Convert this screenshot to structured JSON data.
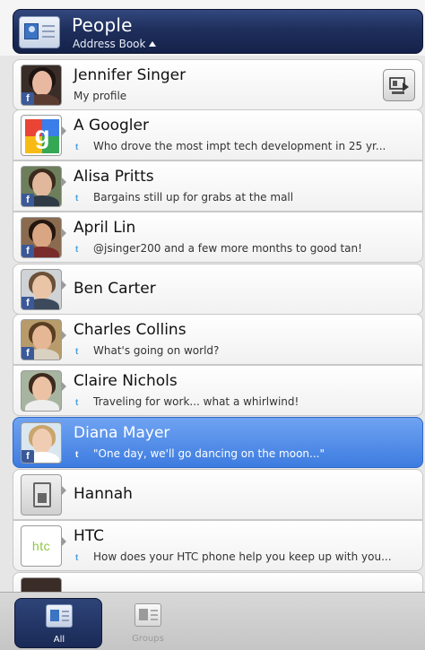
{
  "header": {
    "title": "People",
    "subtitle": "Address Book"
  },
  "contacts": [
    {
      "name": "Jennifer Singer",
      "status": "My profile",
      "avatar": "photo-woman-dark-hair",
      "badge": "f",
      "profile_button_icon": "send-card-icon"
    },
    {
      "name": "A Googler",
      "status": "Who drove the most impt tech development in 25 yr...",
      "avatar": "google-logo",
      "badge": "",
      "status_icon": "twitter-icon"
    },
    {
      "name": "Alisa Pritts",
      "status": "Bargains still up for grabs at the mall",
      "avatar": "photo-woman",
      "badge": "f",
      "status_icon": "twitter-icon"
    },
    {
      "name": "April Lin",
      "status": "@jsinger200 and a few more months to good tan!",
      "avatar": "photo-woman",
      "badge": "f",
      "status_icon": "twitter-icon"
    },
    {
      "name": "Ben Carter",
      "status": "",
      "avatar": "photo-man",
      "badge": "f"
    },
    {
      "name": "Charles Collins",
      "status": "What's going on world?",
      "avatar": "photo-man-smiling",
      "badge": "f",
      "status_icon": "twitter-icon"
    },
    {
      "name": "Claire Nichols",
      "status": "Traveling for work... what a whirlwind!",
      "avatar": "photo-woman",
      "badge": "",
      "status_icon": "twitter-icon"
    },
    {
      "name": "Diana Mayer",
      "status": "\"One day, we'll go dancing on the moon...\"",
      "avatar": "photo-woman-blonde",
      "badge": "f",
      "status_icon": "twitter-icon",
      "selected": true
    },
    {
      "name": "Hannah",
      "status": "",
      "avatar": "sim-card-icon",
      "badge": ""
    },
    {
      "name": "HTC",
      "status": "How does your HTC phone help you keep up with you...",
      "avatar": "htc-logo",
      "badge": "",
      "status_icon": "twitter-icon"
    }
  ],
  "htc_logo_text": "htc",
  "badge_letter": "f",
  "twitter_glyph": "t",
  "google_letter": "g",
  "tabs": [
    {
      "label": "All",
      "active": true
    },
    {
      "label": "Groups",
      "active": false
    }
  ],
  "colors": {
    "header_bg": "#1f2f5c",
    "selected_row": "#4a86e8",
    "facebook": "#3b5998",
    "twitter": "#4aa3e0"
  }
}
